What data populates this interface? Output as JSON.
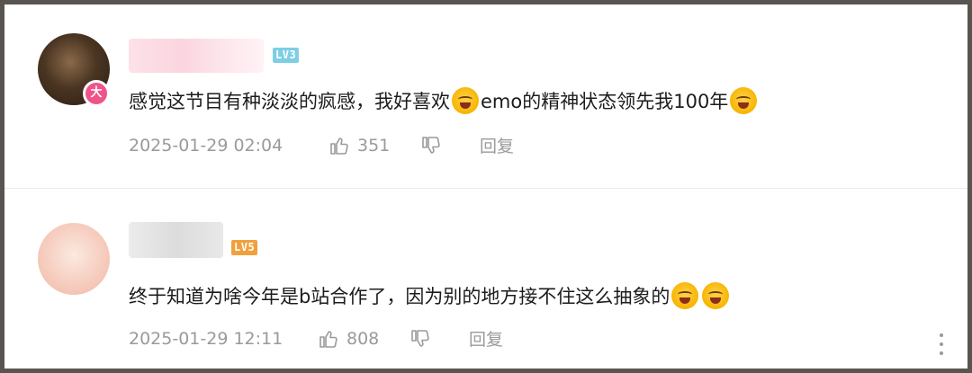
{
  "comments": [
    {
      "level": "LV3",
      "avatar_badge": "大",
      "text_parts": [
        "感觉这节目有种淡淡的疯感，我好喜欢",
        "emo的精神状态领先我100年"
      ],
      "emoji": "crying-laughing-emoji",
      "time": "2025-01-29 02:04",
      "likes": "351",
      "reply_label": "回复"
    },
    {
      "level": "LV5",
      "text_parts": [
        "终于知道为啥今年是b站合作了，因为别的地方接不住这么抽象的"
      ],
      "emoji": "crying-laughing-emoji",
      "time": "2025-01-29 12:11",
      "likes": "808",
      "reply_label": "回复"
    }
  ],
  "colors": {
    "level3": "#7ecfe3",
    "level5": "#f0a13c",
    "badge": "#f0538a",
    "meta_text": "#9a9a9a",
    "body_text": "#1c1c1c"
  }
}
